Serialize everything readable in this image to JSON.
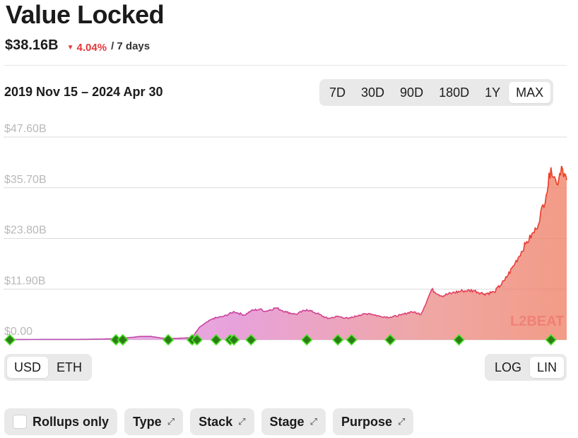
{
  "header": {
    "title": "Value Locked",
    "value": "$38.16B",
    "change": "4.04%",
    "change_color": "#e5383b",
    "period": "/ 7 days"
  },
  "date_range": "2019 Nov 15 – 2024 Apr 30",
  "range_buttons": [
    "7D",
    "30D",
    "90D",
    "180D",
    "1Y",
    "MAX"
  ],
  "range_selected": "MAX",
  "currency_buttons": [
    "USD",
    "ETH"
  ],
  "currency_selected": "USD",
  "scale_buttons": [
    "LOG",
    "LIN"
  ],
  "scale_selected": "LIN",
  "filters": {
    "rollups_only": "Rollups only",
    "type": "Type",
    "stack": "Stack",
    "stage": "Stage",
    "purpose": "Purpose"
  },
  "chart_data": {
    "type": "area",
    "title": "",
    "xlabel": "",
    "ylabel": "",
    "x_range": [
      "2019-11-15",
      "2024-04-30"
    ],
    "ylim": [
      0,
      47.6
    ],
    "y_ticks": [
      "$47.60B",
      "$35.70B",
      "$23.80B",
      "$11.90B",
      "$0.00"
    ],
    "y_tick_values": [
      47.6,
      35.7,
      23.8,
      11.9,
      0
    ],
    "grid": true,
    "watermark": "L2BEAT",
    "colors": {
      "start": "#d77ad6",
      "mid": "#e25a86",
      "end": "#ee4a2c",
      "marker": "#35c519"
    },
    "series": [
      {
        "x": [
          "2019-11-15",
          "2020-03-01",
          "2020-06-01",
          "2020-08-01",
          "2020-10-01",
          "2020-12-01",
          "2021-01-01",
          "2021-02-01",
          "2021-03-01",
          "2021-04-01",
          "2021-05-01",
          "2021-05-20",
          "2021-06-01",
          "2021-07-01",
          "2021-08-01",
          "2021-09-01",
          "2021-10-01",
          "2021-10-20",
          "2021-11-15",
          "2021-12-01",
          "2022-01-01",
          "2022-02-01",
          "2022-03-01",
          "2022-04-01",
          "2022-05-01",
          "2022-06-01",
          "2022-07-01",
          "2022-08-01",
          "2022-09-01",
          "2022-10-01",
          "2022-11-01",
          "2022-12-01",
          "2023-01-01",
          "2023-02-01",
          "2023-03-01",
          "2023-03-20",
          "2023-04-01",
          "2023-05-01",
          "2023-06-01",
          "2023-07-01",
          "2023-08-01",
          "2023-09-01",
          "2023-10-01",
          "2023-11-01",
          "2023-12-01",
          "2024-01-01",
          "2024-02-01",
          "2024-03-01",
          "2024-03-15",
          "2024-04-01",
          "2024-04-15",
          "2024-04-30"
        ],
        "values": [
          0.05,
          0.1,
          0.1,
          0.15,
          0.3,
          0.8,
          0.8,
          0.4,
          0.3,
          0.4,
          0.5,
          2.7,
          3.5,
          5.0,
          5.5,
          6.6,
          5.8,
          6.8,
          7.2,
          6.7,
          7.5,
          6.5,
          6.0,
          7.1,
          6.2,
          5.0,
          5.5,
          5.0,
          5.8,
          6.2,
          5.5,
          5.3,
          5.8,
          6.6,
          6.0,
          9.5,
          11.8,
          10.3,
          11.0,
          11.5,
          11.6,
          10.8,
          11.2,
          14.0,
          18.0,
          22.5,
          26.0,
          34.0,
          40.5,
          36.5,
          40.8,
          37.5
        ]
      }
    ],
    "milestones": [
      "2019-11-15",
      "2020-09-20",
      "2020-10-10",
      "2021-02-20",
      "2021-05-01",
      "2021-05-15",
      "2021-07-10",
      "2021-08-20",
      "2021-08-31",
      "2021-10-20",
      "2022-04-01",
      "2022-07-01",
      "2022-08-10",
      "2022-12-01",
      "2023-06-20",
      "2024-03-15"
    ]
  }
}
